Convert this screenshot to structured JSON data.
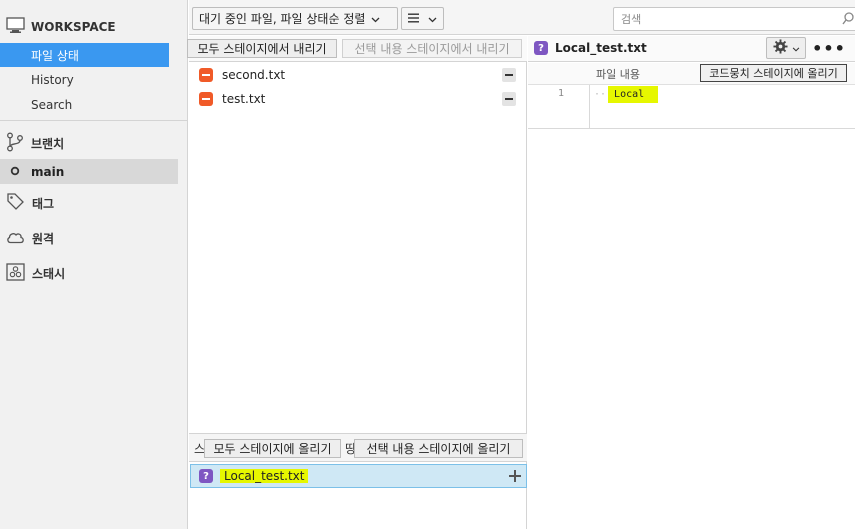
{
  "sidebar": {
    "workspace_label": "WORKSPACE",
    "items": [
      {
        "label": "파일 상태",
        "active": true
      },
      {
        "label": "History",
        "active": false
      },
      {
        "label": "Search",
        "active": false
      }
    ],
    "branches_label": "브랜치",
    "current_branch": "main",
    "tags_label": "태그",
    "remotes_label": "원격",
    "stashes_label": "스태시"
  },
  "toolbar": {
    "sort_dropdown": "대기 중인 파일, 파일 상태순 정렬",
    "view_dropdown_icon": "list-icon",
    "search_placeholder": "검색"
  },
  "unstaged": {
    "unstage_all_button": "모두 스테이지에서 내리기",
    "unstage_selected_button": "선택 내용 스테이지에서 내리기",
    "files": [
      {
        "name": "second.txt",
        "status": "removed"
      },
      {
        "name": "test.txt",
        "status": "removed"
      }
    ]
  },
  "staged": {
    "title_partial": "스",
    "title_tail": "땅",
    "stage_all_button": "모두 스테이지에 올리기",
    "stage_selected_button": "선택 내용 스테이지에 올리기",
    "files": [
      {
        "name": "Local_test.txt",
        "status": "unknown"
      }
    ]
  },
  "diff": {
    "filename": "Local_test.txt",
    "column_label": "파일 내용",
    "stage_hunk_button": "코드뭉치 스테이지에 올리기",
    "lines": [
      {
        "number": "1",
        "text": "Local"
      }
    ],
    "more_label": "•••"
  },
  "colors": {
    "accent": "#3a98f0",
    "removed_badge": "#f05a28",
    "unknown_badge": "#7e57c2",
    "highlight": "#e6f700",
    "selected_row": "#cfe8f5"
  }
}
